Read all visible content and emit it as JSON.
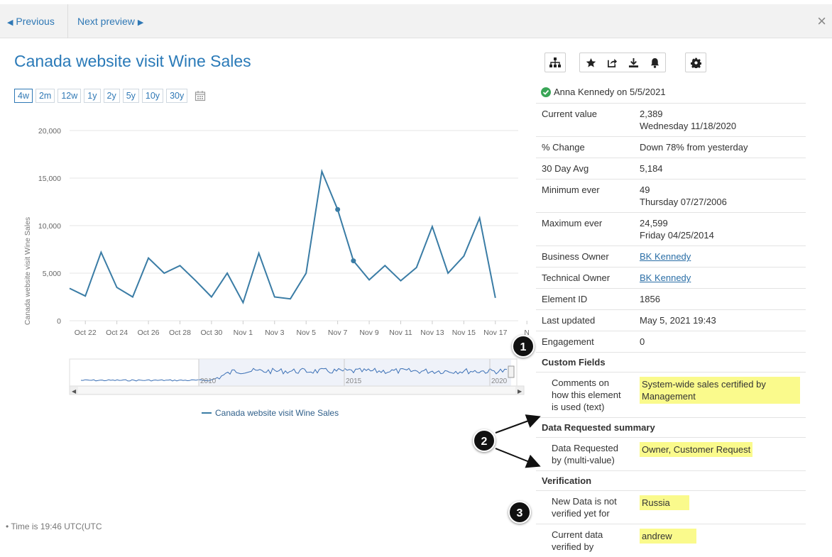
{
  "nav": {
    "previous": "Previous",
    "next": "Next preview",
    "close": "×"
  },
  "title": "Canada website visit Wine Sales",
  "ranges": [
    "4w",
    "2m",
    "12w",
    "1y",
    "2y",
    "5y",
    "10y",
    "30y"
  ],
  "active_range": "4w",
  "footnote": "• Time is 19:46 UTC(UTC",
  "toolbar": {
    "icons": [
      "hierarchy-icon",
      "star-icon",
      "share-icon",
      "download-icon",
      "bell-icon",
      "gear-icon"
    ]
  },
  "verified_by": "Anna Kennedy on 5/5/2021",
  "info_rows": [
    {
      "label": "Current value",
      "value": "2,389",
      "sub": "Wednesday 11/18/2020"
    },
    {
      "label": "% Change",
      "value": "Down 78% from yesterday"
    },
    {
      "label": "30 Day Avg",
      "value": "5,184"
    },
    {
      "label": "Minimum ever",
      "value": "49",
      "sub": "Thursday 07/27/2006"
    },
    {
      "label": "Maximum ever",
      "value": "24,599",
      "sub": "Friday 04/25/2014"
    },
    {
      "label": "Business Owner",
      "value": "BK Kennedy",
      "link": true
    },
    {
      "label": "Technical Owner",
      "value": "BK Kennedy",
      "link": true
    },
    {
      "label": "Element ID",
      "value": "1856"
    },
    {
      "label": "Last updated",
      "value": "May 5, 2021 19:43"
    },
    {
      "label": "Engagement",
      "value": "0"
    }
  ],
  "sections": {
    "custom_fields": {
      "title": "Custom Fields",
      "label": "Comments on how this element is used (text)",
      "value": "System-wide sales certified by Management"
    },
    "data_requested": {
      "title": "Data Requested summary",
      "label": "Data Requested by (multi-value)",
      "value": "Owner, Customer Request"
    },
    "verification": {
      "title": "Verification",
      "rows": [
        {
          "label": "New Data is not verified yet for",
          "value": "Russia"
        },
        {
          "label": "Current data verified by",
          "value": "andrew"
        }
      ]
    }
  },
  "badges": [
    "1",
    "2",
    "3"
  ],
  "colors": {
    "accent": "#2f78b5",
    "line": "#3a7ca5",
    "highlight": "#fafa8c",
    "ok_green": "#3aa657"
  },
  "chart_data": {
    "type": "line",
    "title": "",
    "ylabel": "Canada website visit Wine Sales",
    "ylim": [
      0,
      20000
    ],
    "yticks": [
      0,
      5000,
      10000,
      15000,
      20000
    ],
    "ytick_labels": [
      "0",
      "5,000",
      "10,000",
      "15,000",
      "20,000"
    ],
    "xtick_labels": [
      "Oct 22",
      "Oct 24",
      "Oct 26",
      "Oct 28",
      "Oct 30",
      "Nov 1",
      "Nov 3",
      "Nov 5",
      "Nov 7",
      "Nov 9",
      "Nov 11",
      "Nov 13",
      "Nov 15",
      "Nov 17",
      "N"
    ],
    "x": [
      "Oct 21",
      "Oct 22",
      "Oct 23",
      "Oct 24",
      "Oct 25",
      "Oct 26",
      "Oct 27",
      "Oct 28",
      "Oct 29",
      "Oct 30",
      "Oct 31",
      "Nov 1",
      "Nov 2",
      "Nov 3",
      "Nov 4",
      "Nov 5",
      "Nov 6",
      "Nov 7",
      "Nov 8",
      "Nov 9",
      "Nov 10",
      "Nov 11",
      "Nov 12",
      "Nov 13",
      "Nov 14",
      "Nov 15",
      "Nov 16",
      "Nov 17",
      "Nov 18"
    ],
    "series": [
      {
        "name": "Canada website visit Wine Sales",
        "values": [
          3400,
          2600,
          7200,
          3500,
          2500,
          6600,
          5000,
          5800,
          4200,
          2500,
          5000,
          1900,
          7100,
          2500,
          2300,
          5000,
          15700,
          11700,
          6300,
          4300,
          5800,
          4200,
          5600,
          9900,
          5000,
          6800,
          10800,
          2400
        ]
      }
    ],
    "marked_points": [
      "Nov 7",
      "Nov 8"
    ],
    "navigator_labels": [
      "2010",
      "2015",
      "2020"
    ],
    "legend": "Canada website visit Wine Sales"
  }
}
